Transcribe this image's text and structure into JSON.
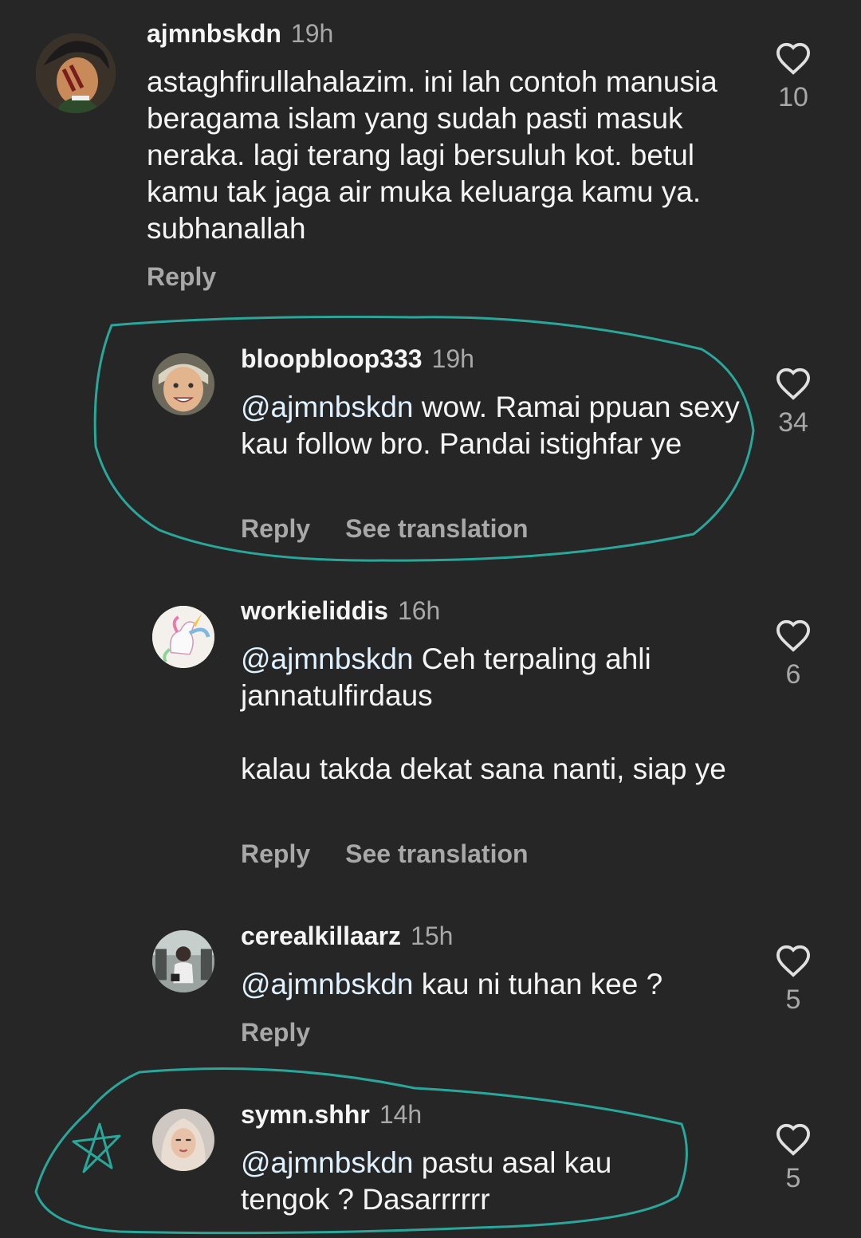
{
  "reply_label": "Reply",
  "see_translation_label": "See translation",
  "annotation_color": "#2aa79b",
  "comments": [
    {
      "username": "ajmnbskdn",
      "time": "19h",
      "text": "astaghfirullahalazim. ini lah contoh manusia beragama islam yang sudah pasti masuk neraka. lagi terang lagi bersuluh kot. betul  kamu tak jaga air muka keluarga kamu ya. subhanallah",
      "likes": "10",
      "avatar_icon": "pirate-character-avatar"
    },
    {
      "username": "bloopbloop333",
      "time": "19h",
      "mention": "@ajmnbskdn",
      "text": " wow. Ramai ppuan sexy kau follow bro. Pandai istighfar ye",
      "likes": "34",
      "avatar_icon": "smiling-person-avatar"
    },
    {
      "username": "workieliddis",
      "time": "16h",
      "mention": "@ajmnbskdn",
      "text": " Ceh terpaling ahli jannatulfirdaus\n\nkalau takda dekat sana nanti, siap ye",
      "likes": "6",
      "avatar_icon": "unicorn-avatar"
    },
    {
      "username": "cerealkillaarz",
      "time": "15h",
      "mention": "@ajmnbskdn",
      "text": " kau ni tuhan kee ?",
      "likes": "5",
      "avatar_icon": "person-photo-avatar"
    },
    {
      "username": "symn.shhr",
      "time": "14h",
      "mention": "@ajmnbskdn",
      "text": " pastu asal kau tengok ? Dasarrrrrr",
      "likes": "5",
      "avatar_icon": "hijab-person-avatar"
    }
  ]
}
